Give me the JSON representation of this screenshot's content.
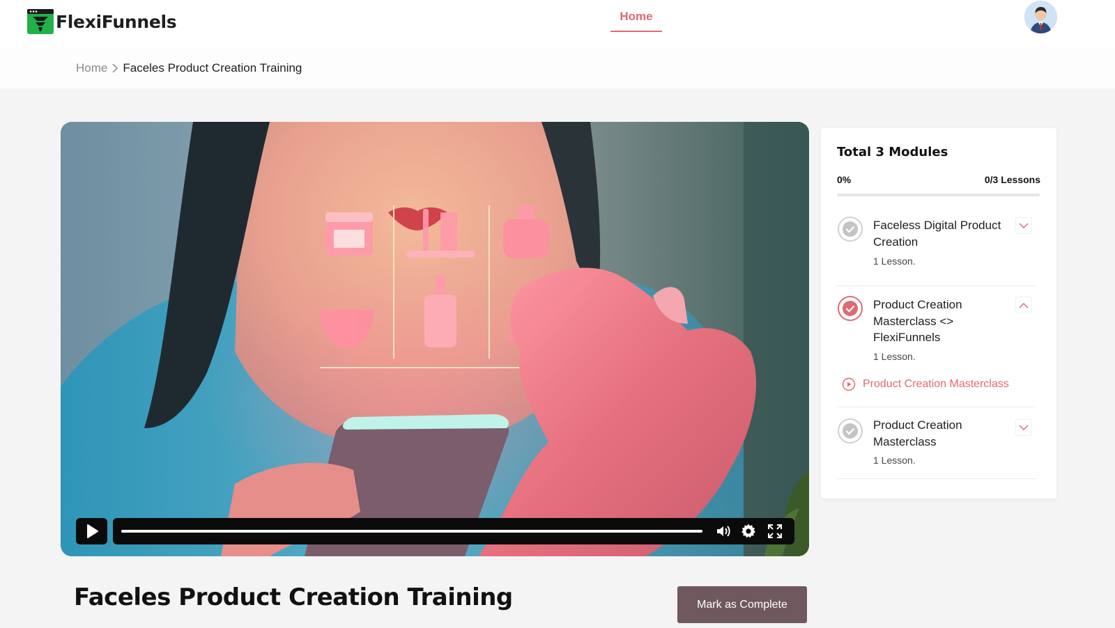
{
  "header": {
    "brand": "FlexiFunnels",
    "nav_home": "Home"
  },
  "breadcrumb": {
    "home": "Home",
    "current": "Faceles Product Creation Training"
  },
  "video": {
    "progress": 1.0
  },
  "lesson": {
    "title": "Faceles Product Creation Training",
    "complete_label": "Mark as Complete"
  },
  "sidebar": {
    "title": "Total 3 Modules",
    "percent": "0%",
    "lessons_count": "0/3 Lessons",
    "progress": 0,
    "modules": [
      {
        "name": "Faceless Digital Product Creation",
        "count": "1 Lesson.",
        "expanded": false,
        "active": false
      },
      {
        "name": "Product Creation Masterclass <> FlexiFunnels",
        "count": "1 Lesson.",
        "expanded": true,
        "active": true,
        "lessons": [
          {
            "name": "Product Creation Masterclass"
          }
        ]
      },
      {
        "name": "Product Creation Masterclass",
        "count": "1 Lesson.",
        "expanded": false,
        "active": false
      }
    ]
  },
  "colors": {
    "accent": "#e06a72",
    "button_bg": "#6f585e",
    "logo_green": "#22b04b"
  }
}
